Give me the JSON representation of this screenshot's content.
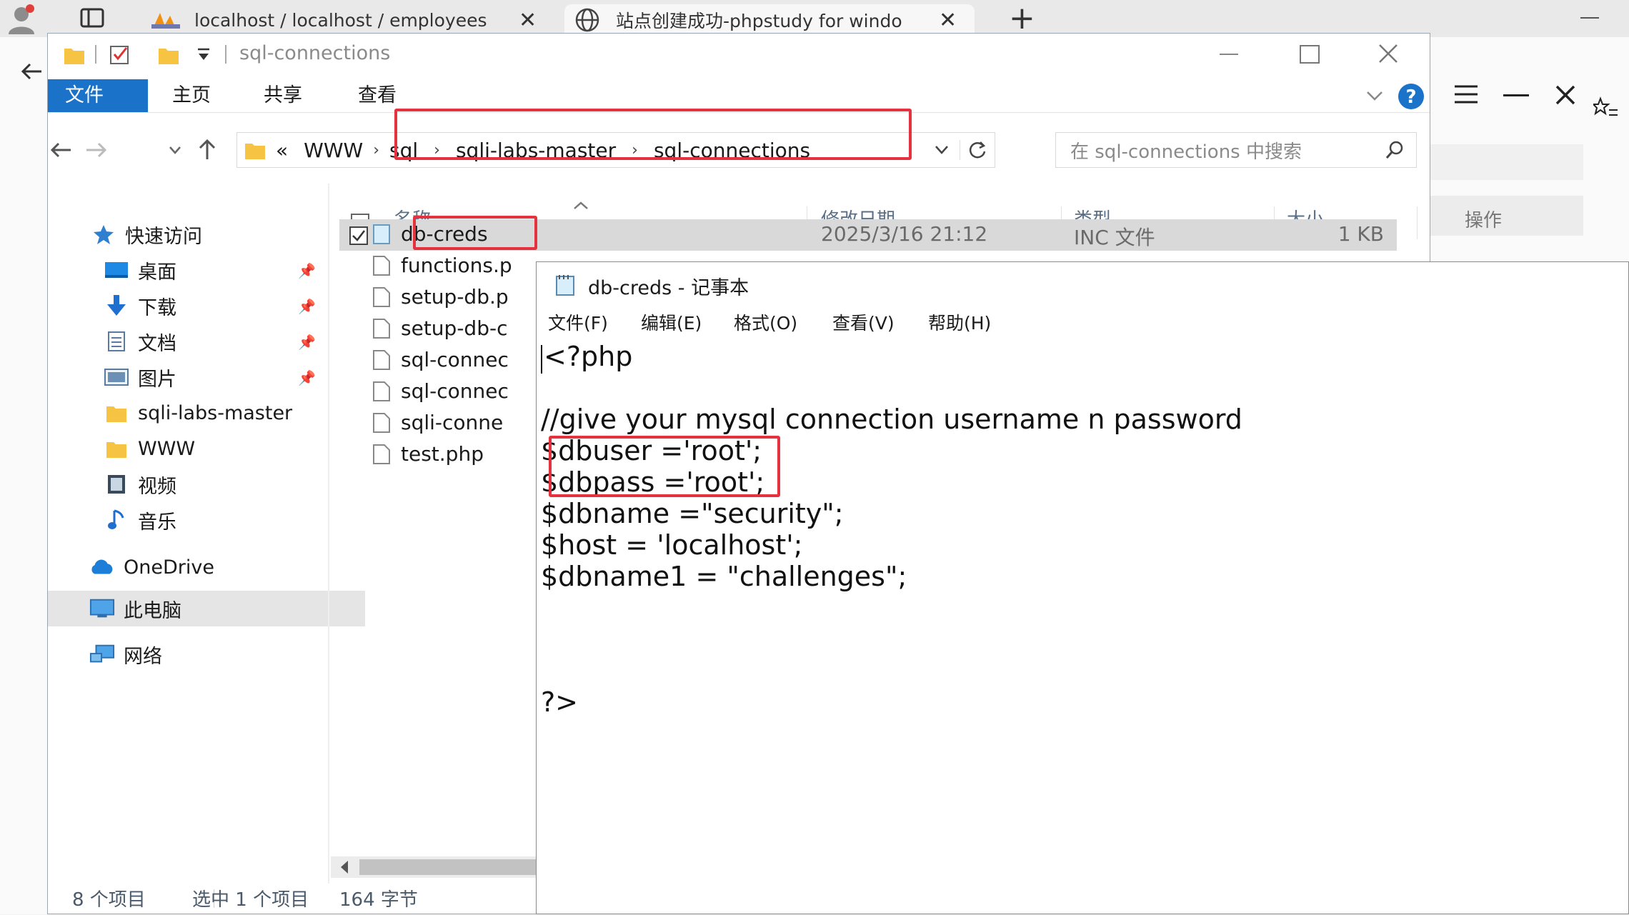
{
  "browser": {
    "tabs": [
      {
        "title": "localhost / localhost / employees",
        "close": "✕"
      },
      {
        "title": "站点创建成功-phpstudy for windo",
        "close": "✕"
      }
    ],
    "new_tab": "+",
    "side_panel_label": "操作"
  },
  "explorer": {
    "window_title": "sql-connections",
    "ribbon_tabs": [
      {
        "label": "文件",
        "active": true
      },
      {
        "label": "主页",
        "active": false
      },
      {
        "label": "共享",
        "active": false
      },
      {
        "label": "查看",
        "active": false
      }
    ],
    "address": {
      "overflow": "«",
      "crumbs": [
        "WWW",
        "sql",
        "sqli-labs-master",
        "sql-connections"
      ]
    },
    "search_placeholder": "在 sql-connections 中搜索",
    "columns": {
      "name": "名称",
      "date": "修改日期",
      "type": "类型",
      "size": "大小"
    },
    "nav_pane": {
      "quick_access": "快速访问",
      "items": [
        "桌面",
        "下载",
        "文档",
        "图片",
        "sqli-labs-master",
        "WWW",
        "视频",
        "音乐"
      ],
      "onedrive": "OneDrive",
      "this_pc": "此电脑",
      "network": "网络"
    },
    "files": [
      {
        "name": "db-creds",
        "date": "2025/3/16 21:12",
        "type": "INC 文件",
        "size": "1 KB",
        "selected": true
      },
      {
        "name": "functions.p",
        "selected": false
      },
      {
        "name": "setup-db.p",
        "selected": false
      },
      {
        "name": "setup-db-c",
        "selected": false
      },
      {
        "name": "sql-connec",
        "selected": false
      },
      {
        "name": "sql-connec",
        "selected": false
      },
      {
        "name": "sqli-conne",
        "selected": false
      },
      {
        "name": "test.php",
        "selected": false
      }
    ],
    "status": {
      "count": "8 个项目",
      "selected": "选中 1 个项目",
      "bytes": "164 字节"
    }
  },
  "notepad": {
    "title": "db-creds - 记事本",
    "menu": [
      "文件(F)",
      "编辑(E)",
      "格式(O)",
      "查看(V)",
      "帮助(H)"
    ],
    "lines": [
      "<?php",
      "",
      "//give your mysql connection username n password",
      "$dbuser ='root';",
      "$dbpass ='root';",
      "$dbname =\"security\";",
      "$host = 'localhost';",
      "$dbname1 = \"challenges\";",
      "",
      "",
      "",
      "?>"
    ]
  },
  "colors": {
    "accent": "#1a73c8",
    "highlight": "#e5323f",
    "folder": "#f6c343"
  }
}
